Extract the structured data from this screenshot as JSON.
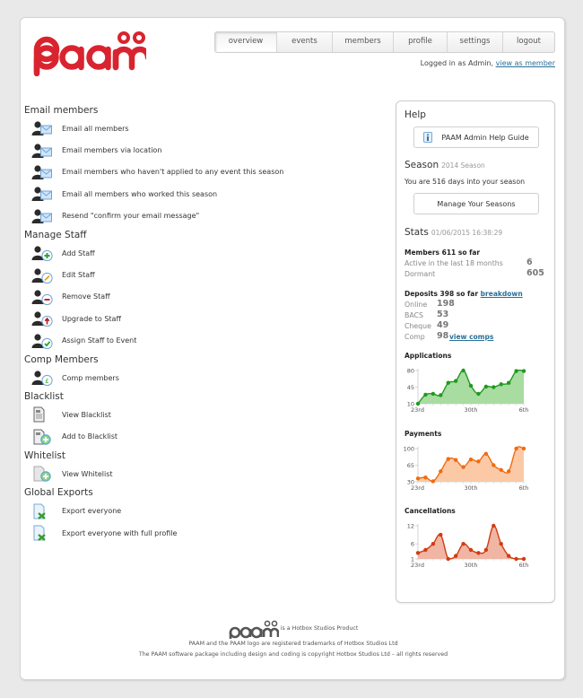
{
  "brand": {
    "name": "paam",
    "color": "#d9242f"
  },
  "nav": {
    "tabs": [
      {
        "label": "overview",
        "active": true
      },
      {
        "label": "events",
        "active": false
      },
      {
        "label": "members",
        "active": false
      },
      {
        "label": "profile",
        "active": false
      },
      {
        "label": "settings",
        "active": false
      },
      {
        "label": "logout",
        "active": false
      }
    ]
  },
  "session": {
    "logged_in_text": "Logged in as Admin,",
    "view_as_member_link": "view as member"
  },
  "sections": [
    {
      "title": "Email members",
      "items": [
        {
          "label": "Email all members",
          "icon": "user-email-icon"
        },
        {
          "label": "Email members via location",
          "icon": "user-email-icon"
        },
        {
          "label": "Email members who haven't applied to any event this season",
          "icon": "user-email-icon"
        },
        {
          "label": "Email all members who worked this season",
          "icon": "user-email-icon"
        },
        {
          "label": "Resend \"confirm your email message\"",
          "icon": "user-email-icon"
        }
      ]
    },
    {
      "title": "Manage Staff",
      "items": [
        {
          "label": "Add Staff",
          "icon": "user-add-icon"
        },
        {
          "label": "Edit Staff",
          "icon": "user-edit-icon"
        },
        {
          "label": "Remove Staff",
          "icon": "user-remove-icon"
        },
        {
          "label": "Upgrade to Staff",
          "icon": "user-upgrade-icon"
        },
        {
          "label": "Assign Staff to Event",
          "icon": "user-check-icon"
        }
      ]
    },
    {
      "title": "Comp Members",
      "items": [
        {
          "label": "Comp members",
          "icon": "user-pound-icon"
        }
      ]
    },
    {
      "title": "Blacklist",
      "items": [
        {
          "label": "View Blacklist",
          "icon": "document-icon"
        },
        {
          "label": "Add to Blacklist",
          "icon": "document-add-icon"
        }
      ]
    },
    {
      "title": "Whitelist",
      "items": [
        {
          "label": "View Whitelist",
          "icon": "blank-document-add-icon"
        }
      ]
    },
    {
      "title": "Global Exports",
      "items": [
        {
          "label": "Export everyone",
          "icon": "excel-export-icon"
        },
        {
          "label": "Export everyone with full profile",
          "icon": "excel-export-icon"
        }
      ]
    }
  ],
  "sidebar": {
    "help": {
      "title": "Help",
      "button": "PAAM Admin Help Guide"
    },
    "season": {
      "title": "Season",
      "subtitle": "2014 Season",
      "text": "You are 516 days into your season",
      "button": "Manage Your Seasons"
    },
    "stats": {
      "title": "Stats",
      "timestamp": "01/06/2015 16:38:29",
      "members": {
        "heading": "Members 611 so far",
        "rows": [
          {
            "label": "Active in the last 18 months",
            "value": "6"
          },
          {
            "label": "Dormant",
            "value": "605"
          }
        ]
      },
      "deposits": {
        "heading": "Deposits 398 so far",
        "breakdown_link": "breakdown",
        "rows": [
          {
            "label": "Online",
            "value": "198"
          },
          {
            "label": "BACS",
            "value": "53"
          },
          {
            "label": "Cheque",
            "value": "49"
          },
          {
            "label": "Comp",
            "value": "98"
          }
        ],
        "view_comps_link": "view comps"
      }
    }
  },
  "chart_data": [
    {
      "type": "area",
      "title": "Applications",
      "color": "#1f9a1f",
      "fill": "#a8dca0",
      "x": [
        "23rd",
        "24th",
        "25th",
        "26th",
        "27th",
        "28th",
        "29th",
        "30th",
        "31st",
        "1st",
        "2nd",
        "3rd",
        "4th",
        "5th",
        "6th"
      ],
      "values": [
        10,
        29,
        31,
        28,
        54,
        58,
        80,
        48,
        31,
        46,
        45,
        51,
        54,
        79,
        79
      ],
      "yticks": [
        10,
        45,
        80
      ],
      "xtick_labels": [
        "23rd",
        "30th",
        "6th"
      ],
      "ylim": [
        10,
        80
      ]
    },
    {
      "type": "area",
      "title": "Payments",
      "color": "#f26b0f",
      "fill": "#fbc9a6",
      "x": [
        "23rd",
        "24th",
        "25th",
        "26th",
        "27th",
        "28th",
        "29th",
        "30th",
        "31st",
        "1st",
        "2nd",
        "3rd",
        "4th",
        "5th",
        "6th"
      ],
      "values": [
        37,
        39,
        31,
        52,
        78,
        76,
        61,
        77,
        73,
        89,
        65,
        55,
        52,
        100,
        100
      ],
      "yticks": [
        30,
        65,
        100
      ],
      "xtick_labels": [
        "23rd",
        "30th",
        "6th"
      ],
      "ylim": [
        30,
        100
      ]
    },
    {
      "type": "area",
      "title": "Cancellations",
      "color": "#d13b12",
      "fill": "#f0b5a3",
      "x": [
        "23rd",
        "24th",
        "25th",
        "26th",
        "27th",
        "28th",
        "29th",
        "30th",
        "31st",
        "1st",
        "2nd",
        "3rd",
        "4th",
        "5th",
        "6th"
      ],
      "values": [
        3,
        4,
        6,
        9,
        1,
        2,
        6,
        4,
        3,
        4,
        12,
        6,
        2,
        1,
        1
      ],
      "yticks": [
        1,
        6,
        12
      ],
      "xtick_labels": [
        "23rd",
        "30th",
        "6th"
      ],
      "ylim": [
        1,
        12
      ]
    }
  ],
  "footer": {
    "product_text": "is a Hotbox Studios Product",
    "trademark_text": "PAAM and the PAAM logo are registered trademarks of Hotbox Studios Ltd",
    "copyright_text": "The PAAM software package including design and coding is copyright Hotbox Studios Ltd – all rights reserved"
  }
}
